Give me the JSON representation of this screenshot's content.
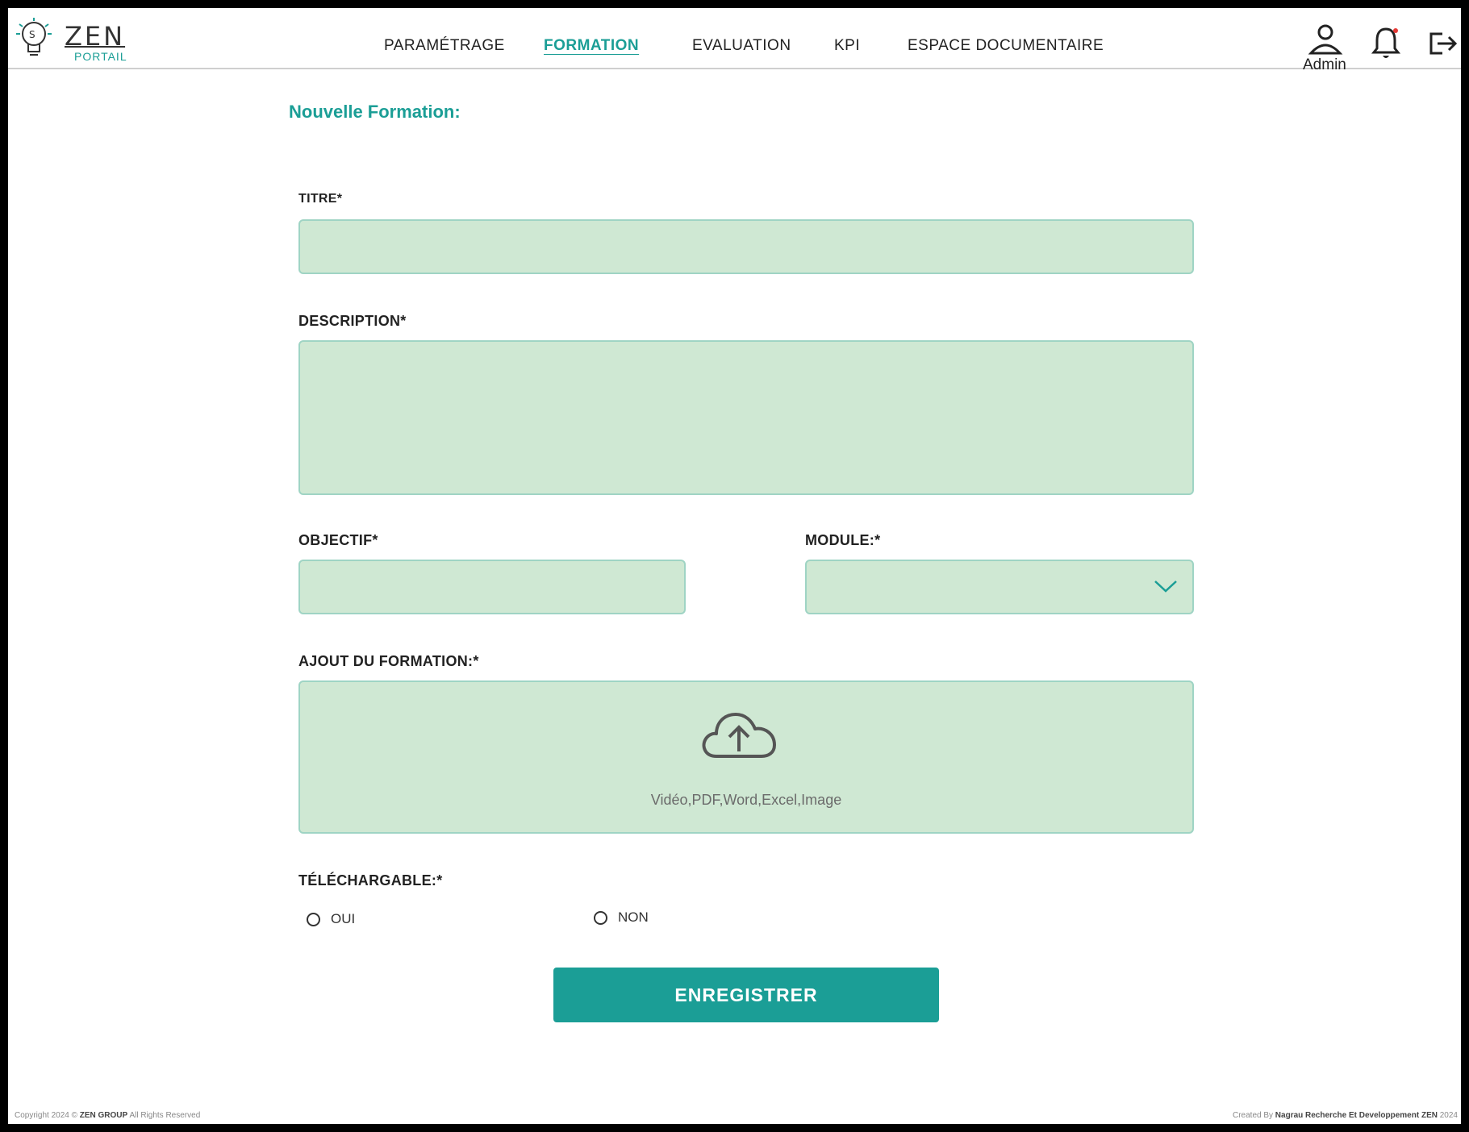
{
  "brand": {
    "name": "ZEN",
    "subtitle": "PORTAIL"
  },
  "nav": {
    "items": [
      {
        "label": "PARAMÉTRAGE",
        "active": false
      },
      {
        "label": "FORMATION",
        "active": true
      },
      {
        "label": "EVALUATION",
        "active": false
      },
      {
        "label": "KPI",
        "active": false
      },
      {
        "label": "ESPACE DOCUMENTAIRE",
        "active": false
      }
    ]
  },
  "user": {
    "name": "Admin",
    "icon": "user-icon"
  },
  "icons": {
    "notifications": "bell-icon",
    "logout": "logout-icon",
    "upload": "cloud-upload-icon",
    "select": "chevron-down-icon"
  },
  "form": {
    "title": "Nouvelle Formation:",
    "titre_label": "TITRE*",
    "titre_value": "",
    "description_label": "DESCRIPTION*",
    "description_value": "",
    "objectif_label": "OBJECTIF*",
    "objectif_value": "",
    "module_label": "MODULE:*",
    "module_value": "",
    "upload_label": "AJOUT DU FORMATION:*",
    "upload_hint": "Vidéo,PDF,Word,Excel,Image",
    "telechargeable_label": "TÉLÉCHARGABLE:*",
    "options": {
      "oui": "OUI",
      "non": "NON"
    },
    "save_label": "ENREGISTRER"
  },
  "footer": {
    "left_prefix": "Copyright 2024 ©",
    "left_brand": "ZEN GROUP",
    "left_suffix": "All Rights Reserved",
    "right_prefix": "Created By",
    "right_brand": "Nagrau Recherche Et Developpement ZEN",
    "right_suffix": "2024"
  },
  "colors": {
    "accent": "#1b9e96",
    "field_bg": "#cfe8d3",
    "field_border": "#9fd4c4"
  }
}
